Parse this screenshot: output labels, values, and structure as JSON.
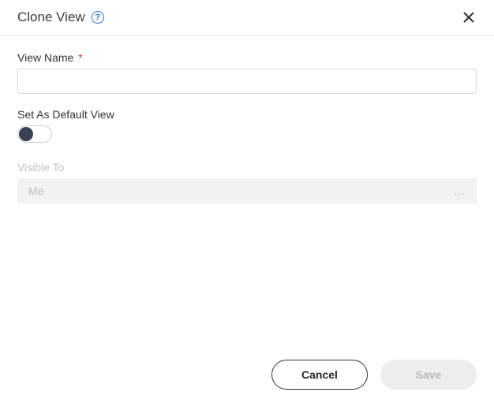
{
  "header": {
    "title": "Clone View",
    "help_glyph": "?"
  },
  "form": {
    "view_name": {
      "label": "View Name",
      "required_mark": "*",
      "value": ""
    },
    "default_view": {
      "label": "Set As Default View",
      "on": false
    },
    "visible_to": {
      "label": "Visible To",
      "value": "Me",
      "more_glyph": "..."
    }
  },
  "footer": {
    "cancel": "Cancel",
    "save": "Save"
  }
}
